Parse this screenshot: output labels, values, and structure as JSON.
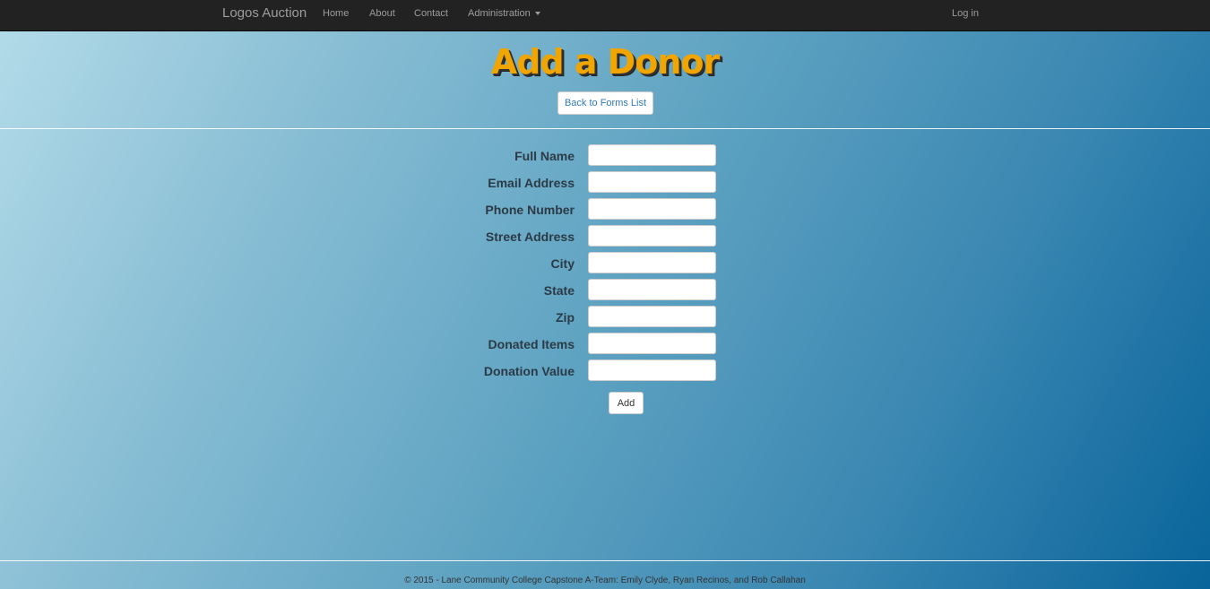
{
  "navbar": {
    "brand": "Logos Auction",
    "links": [
      "Home",
      "About",
      "Contact",
      "Administration"
    ],
    "login": "Log in"
  },
  "page": {
    "title": "Add a Donor",
    "back_button": "Back to Forms List"
  },
  "form": {
    "fields": [
      {
        "label": "Full Name",
        "value": ""
      },
      {
        "label": "Email Address",
        "value": ""
      },
      {
        "label": "Phone Number",
        "value": ""
      },
      {
        "label": "Street Address",
        "value": ""
      },
      {
        "label": "City",
        "value": ""
      },
      {
        "label": "State",
        "value": ""
      },
      {
        "label": "Zip",
        "value": ""
      },
      {
        "label": "Donated Items",
        "value": ""
      },
      {
        "label": "Donation Value",
        "value": ""
      }
    ],
    "submit": "Add"
  },
  "footer": {
    "text": "© 2015 - Lane Community College Capstone A-Team: Emily Clyde, Ryan Recinos, and Rob Callahan"
  },
  "colors": {
    "navbar_bg": "#222222",
    "nav_text": "#9d9d9d",
    "title": "#f0a500",
    "link": "#337ab7"
  }
}
